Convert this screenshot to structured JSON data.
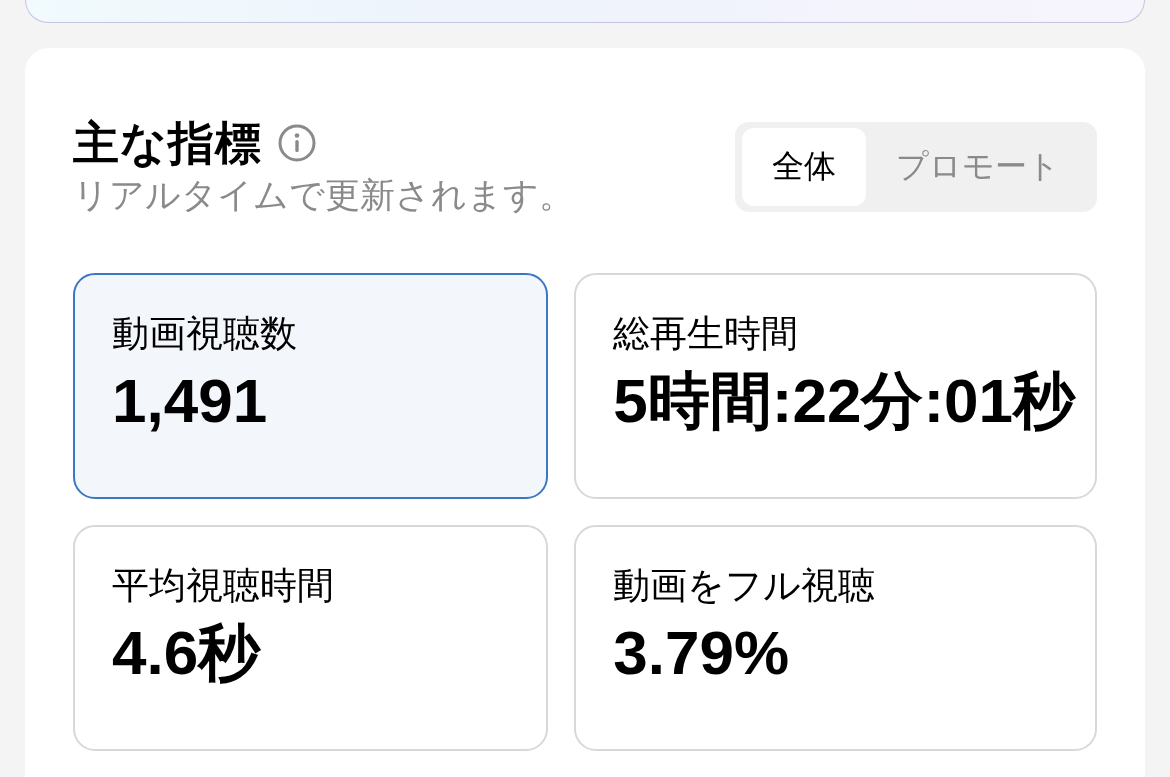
{
  "header": {
    "title": "主な指標",
    "subtitle": "リアルタイムで更新されます。"
  },
  "tabs": [
    {
      "label": "全体",
      "selected": true
    },
    {
      "label": "プロモート",
      "selected": false
    }
  ],
  "metrics": [
    {
      "label": "動画視聴数",
      "value": "1,491",
      "selected": true
    },
    {
      "label": "総再生時間",
      "value": "5時間:22分:01秒",
      "selected": false
    },
    {
      "label": "平均視聴時間",
      "value": "4.6秒",
      "selected": false
    },
    {
      "label": "動画をフル視聴",
      "value": "3.79%",
      "selected": false
    }
  ]
}
